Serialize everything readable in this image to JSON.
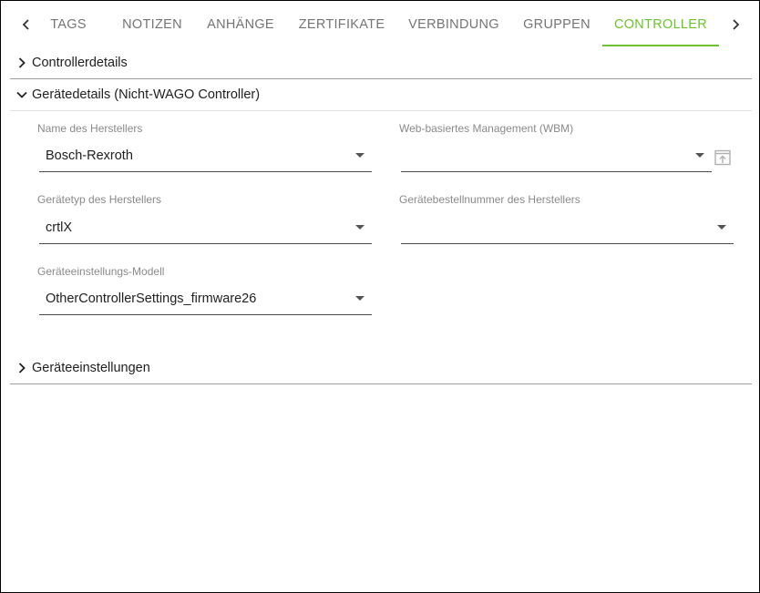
{
  "tabs": [
    {
      "label": "TAGS"
    },
    {
      "label": "NOTIZEN"
    },
    {
      "label": "ANHÄNGE"
    },
    {
      "label": "ZERTIFIKATE"
    },
    {
      "label": "VERBINDUNG"
    },
    {
      "label": "GRUPPEN"
    },
    {
      "label": "CONTROLLER",
      "active": true
    }
  ],
  "accent_color": "#6cc230",
  "panels": {
    "controller_details": {
      "title": "Controllerdetails",
      "expanded": false
    },
    "device_details": {
      "title": "Gerätedetails (Nicht-WAGO Controller)",
      "expanded": true
    },
    "device_settings": {
      "title": "Geräteeinstellungen",
      "expanded": false
    }
  },
  "fields": {
    "manufacturer_name": {
      "label": "Name des Herstellers",
      "value": "Bosch-Rexroth"
    },
    "wbm": {
      "label": "Web-basiertes Management (WBM)",
      "value": ""
    },
    "device_type": {
      "label": "Gerätetyp des Herstellers",
      "value": "crtlX"
    },
    "order_number": {
      "label": "Gerätebestellnummer des Herstellers",
      "value": ""
    },
    "settings_model": {
      "label": "Geräteeinstellungs-Modell",
      "value": "OtherControllerSettings_firmware26"
    }
  },
  "icons": {
    "tab_prev": "chevron-left-icon",
    "tab_next": "chevron-right-icon",
    "collapsed": "chevron-right-icon",
    "expanded": "chevron-down-icon",
    "wbm_open": "open-in-browser-icon"
  }
}
